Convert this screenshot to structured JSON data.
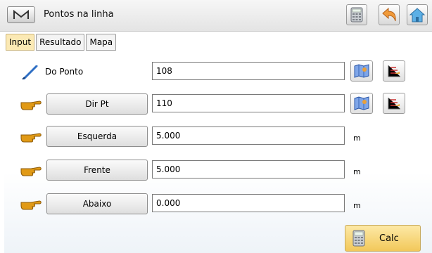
{
  "header": {
    "menu_label": "M",
    "title": "Pontos na linha",
    "calculator_icon": "calculator-icon",
    "back_icon": "back-arrow-icon",
    "home_icon": "home-icon"
  },
  "tabs": [
    {
      "label": "Input",
      "active": true
    },
    {
      "label": "Resultado",
      "active": false
    },
    {
      "label": "Mapa",
      "active": false
    }
  ],
  "form": {
    "from_point": {
      "label": "Do Ponto",
      "value": "108",
      "icon": "pencil-icon"
    },
    "dir_point": {
      "label": "Dir Pt",
      "value": "110",
      "icon": "pointing-hand-icon"
    },
    "left": {
      "label": "Esquerda",
      "value": "5.000",
      "unit": "m",
      "icon": "pointing-hand-icon"
    },
    "front": {
      "label": "Frente",
      "value": "5.000",
      "unit": "m",
      "icon": "pointing-hand-icon"
    },
    "below": {
      "label": "Abaixo",
      "value": "0.000",
      "unit": "m",
      "icon": "pointing-hand-icon"
    }
  },
  "calc_button": {
    "label": "Calc",
    "icon": "calculator-icon"
  },
  "colors": {
    "active_tab": "#fbe9b4",
    "calc_button": "#f5d171",
    "hand_icon": "#e19a16"
  }
}
